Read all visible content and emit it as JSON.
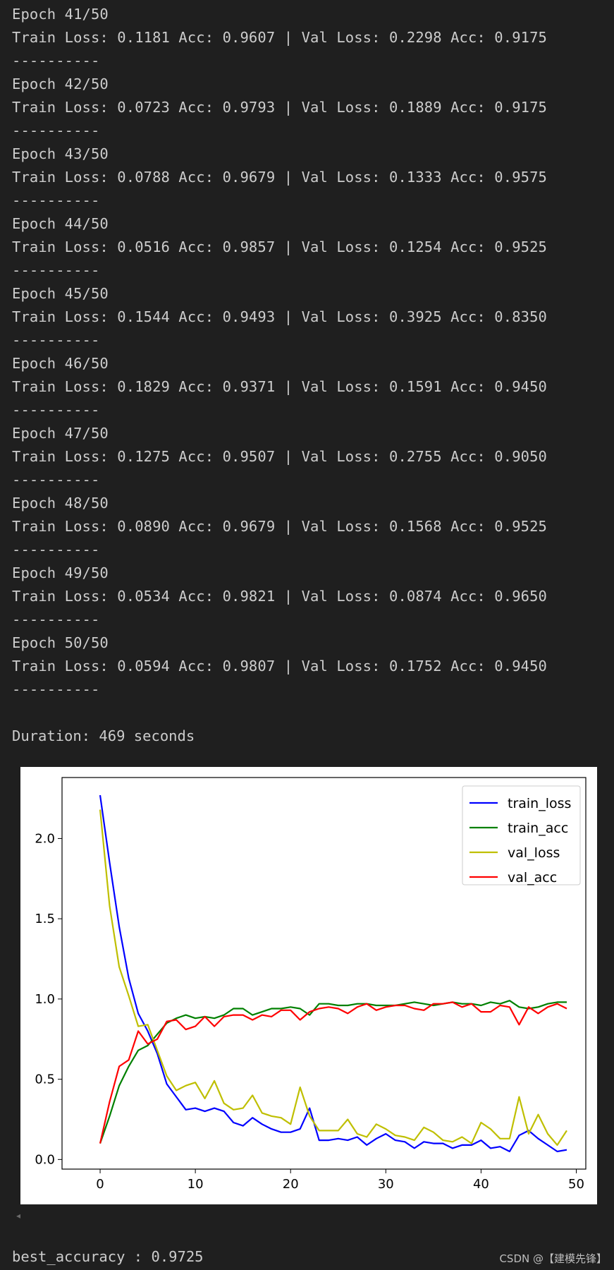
{
  "log": [
    {
      "epoch": "Epoch 41/50",
      "metrics": "Train Loss: 0.1181 Acc: 0.9607 | Val Loss: 0.2298 Acc: 0.9175",
      "sep": "----------"
    },
    {
      "epoch": "Epoch 42/50",
      "metrics": "Train Loss: 0.0723 Acc: 0.9793 | Val Loss: 0.1889 Acc: 0.9175",
      "sep": "----------"
    },
    {
      "epoch": "Epoch 43/50",
      "metrics": "Train Loss: 0.0788 Acc: 0.9679 | Val Loss: 0.1333 Acc: 0.9575",
      "sep": "----------"
    },
    {
      "epoch": "Epoch 44/50",
      "metrics": "Train Loss: 0.0516 Acc: 0.9857 | Val Loss: 0.1254 Acc: 0.9525",
      "sep": "----------"
    },
    {
      "epoch": "Epoch 45/50",
      "metrics": "Train Loss: 0.1544 Acc: 0.9493 | Val Loss: 0.3925 Acc: 0.8350",
      "sep": "----------"
    },
    {
      "epoch": "Epoch 46/50",
      "metrics": "Train Loss: 0.1829 Acc: 0.9371 | Val Loss: 0.1591 Acc: 0.9450",
      "sep": "----------"
    },
    {
      "epoch": "Epoch 47/50",
      "metrics": "Train Loss: 0.1275 Acc: 0.9507 | Val Loss: 0.2755 Acc: 0.9050",
      "sep": "----------"
    },
    {
      "epoch": "Epoch 48/50",
      "metrics": "Train Loss: 0.0890 Acc: 0.9679 | Val Loss: 0.1568 Acc: 0.9525",
      "sep": "----------"
    },
    {
      "epoch": "Epoch 49/50",
      "metrics": "Train Loss: 0.0534 Acc: 0.9821 | Val Loss: 0.0874 Acc: 0.9650",
      "sep": "----------"
    },
    {
      "epoch": "Epoch 50/50",
      "metrics": "Train Loss: 0.0594 Acc: 0.9807 | Val Loss: 0.1752 Acc: 0.9450",
      "sep": "----------"
    }
  ],
  "duration": "Duration: 469 seconds",
  "best_accuracy": "best_accuracy : 0.9725",
  "watermark": "CSDN @【建模先锋】",
  "scroll_arrow": "◂",
  "chart_data": {
    "type": "line",
    "xlim": [
      -4,
      51
    ],
    "ylim": [
      -0.06,
      2.38
    ],
    "xticks": [
      0,
      10,
      20,
      30,
      40,
      50
    ],
    "yticks": [
      0.0,
      0.5,
      1.0,
      1.5,
      2.0
    ],
    "xtick_labels": [
      "0",
      "10",
      "20",
      "30",
      "40",
      "50"
    ],
    "ytick_labels": [
      "0.0",
      "0.5",
      "1.0",
      "1.5",
      "2.0"
    ],
    "legend_position": "top-right",
    "grid": false,
    "series": [
      {
        "name": "train_loss",
        "color": "#0000ff",
        "values": [
          2.27,
          1.85,
          1.45,
          1.13,
          0.91,
          0.8,
          0.66,
          0.47,
          0.39,
          0.31,
          0.32,
          0.3,
          0.32,
          0.3,
          0.23,
          0.21,
          0.26,
          0.22,
          0.19,
          0.17,
          0.17,
          0.19,
          0.32,
          0.12,
          0.12,
          0.13,
          0.12,
          0.14,
          0.09,
          0.13,
          0.16,
          0.12,
          0.11,
          0.07,
          0.11,
          0.1,
          0.1,
          0.07,
          0.09,
          0.09,
          0.12,
          0.07,
          0.08,
          0.05,
          0.15,
          0.18,
          0.13,
          0.09,
          0.05,
          0.06
        ]
      },
      {
        "name": "train_acc",
        "color": "#008000",
        "values": [
          0.1,
          0.27,
          0.46,
          0.58,
          0.68,
          0.71,
          0.78,
          0.85,
          0.88,
          0.9,
          0.88,
          0.89,
          0.88,
          0.9,
          0.94,
          0.94,
          0.9,
          0.92,
          0.94,
          0.94,
          0.95,
          0.94,
          0.9,
          0.97,
          0.97,
          0.96,
          0.96,
          0.97,
          0.97,
          0.96,
          0.96,
          0.96,
          0.97,
          0.98,
          0.97,
          0.96,
          0.97,
          0.98,
          0.97,
          0.97,
          0.96,
          0.98,
          0.97,
          0.99,
          0.95,
          0.94,
          0.95,
          0.97,
          0.98,
          0.98
        ]
      },
      {
        "name": "val_loss",
        "color": "#bfbf00",
        "values": [
          2.18,
          1.58,
          1.2,
          1.02,
          0.83,
          0.84,
          0.68,
          0.52,
          0.43,
          0.46,
          0.48,
          0.38,
          0.49,
          0.35,
          0.31,
          0.32,
          0.4,
          0.29,
          0.27,
          0.26,
          0.22,
          0.45,
          0.27,
          0.18,
          0.18,
          0.18,
          0.25,
          0.16,
          0.14,
          0.22,
          0.19,
          0.15,
          0.14,
          0.12,
          0.2,
          0.17,
          0.12,
          0.11,
          0.14,
          0.1,
          0.23,
          0.19,
          0.13,
          0.13,
          0.39,
          0.16,
          0.28,
          0.16,
          0.09,
          0.18
        ]
      },
      {
        "name": "val_acc",
        "color": "#ff0000",
        "values": [
          0.1,
          0.36,
          0.58,
          0.62,
          0.8,
          0.72,
          0.75,
          0.86,
          0.87,
          0.81,
          0.83,
          0.89,
          0.83,
          0.89,
          0.9,
          0.9,
          0.87,
          0.9,
          0.89,
          0.93,
          0.93,
          0.87,
          0.92,
          0.94,
          0.95,
          0.94,
          0.91,
          0.95,
          0.97,
          0.93,
          0.95,
          0.96,
          0.96,
          0.94,
          0.93,
          0.97,
          0.97,
          0.98,
          0.95,
          0.97,
          0.92,
          0.92,
          0.96,
          0.95,
          0.84,
          0.95,
          0.91,
          0.95,
          0.97,
          0.94
        ]
      }
    ]
  }
}
